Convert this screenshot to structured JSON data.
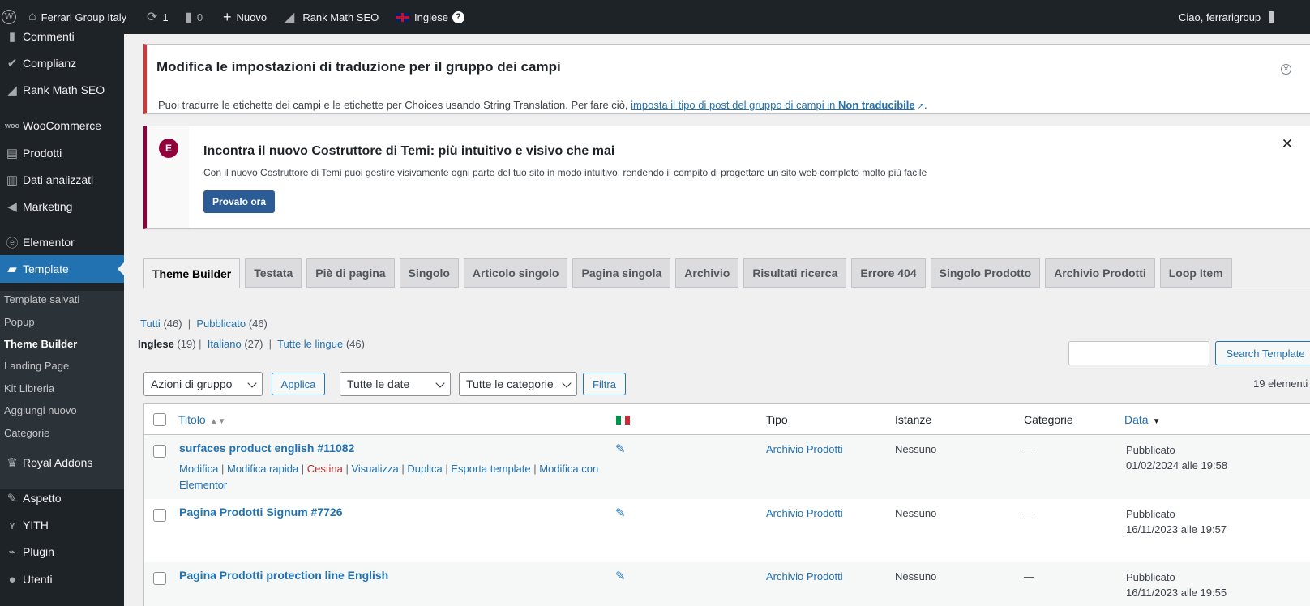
{
  "admin_bar": {
    "site_name": "Ferrari Group Italy",
    "updates_count": "1",
    "comments_count": "0",
    "new_label": "Nuovo",
    "rank_math_label": "Rank Math SEO",
    "language_label": "Inglese",
    "help_label": "?",
    "greeting": "Ciao, ferrarigroup"
  },
  "sidebar": {
    "items": [
      {
        "label": "Commenti",
        "icon": "comment-icon"
      },
      {
        "label": "Complianz",
        "icon": "check-icon"
      },
      {
        "label": "Rank Math SEO",
        "icon": "chart-icon"
      },
      {
        "label": "WooCommerce",
        "icon": "woo-icon"
      },
      {
        "label": "Prodotti",
        "icon": "archive-icon"
      },
      {
        "label": "Dati analizzati",
        "icon": "bar-chart-icon"
      },
      {
        "label": "Marketing",
        "icon": "megaphone-icon"
      },
      {
        "label": "Elementor",
        "icon": "elementor-icon"
      },
      {
        "label": "Template",
        "icon": "folder-icon"
      },
      {
        "label": "Royal Addons",
        "icon": "crown-icon"
      },
      {
        "label": "Aspetto",
        "icon": "brush-icon"
      },
      {
        "label": "YITH",
        "icon": "yith-icon"
      },
      {
        "label": "Plugin",
        "icon": "plug-icon"
      },
      {
        "label": "Utenti",
        "icon": "user-icon"
      }
    ],
    "submenu": [
      "Template salvati",
      "Popup",
      "Theme Builder",
      "Landing Page",
      "Kit Libreria",
      "Aggiungi nuovo",
      "Categorie"
    ]
  },
  "acf_notice": {
    "title": "Modifica le impostazioni di traduzione per il gruppo dei campi",
    "text": "Puoi tradurre le etichette dei campi e le etichette per Choices usando String Translation. Per fare ciò, ",
    "link_text": "imposta il tipo di post del gruppo di campi in ",
    "link_bold": "Non traducibile",
    "link_suffix": "."
  },
  "elementor_notice": {
    "logo": "E",
    "title": "Incontra il nuovo Costruttore di Temi: più intuitivo e visivo che mai",
    "text": "Con il nuovo Costruttore di Temi puoi gestire visivamente ogni parte del tuo sito in modo intuitivo, rendendo il compito di progettare un sito web completo molto più facile",
    "button": "Provalo ora"
  },
  "tabs": [
    "Theme Builder",
    "Testata",
    "Piè di pagina",
    "Singolo",
    "Articolo singolo",
    "Pagina singola",
    "Archivio",
    "Risultati ricerca",
    "Errore 404",
    "Singolo Prodotto",
    "Archivio Prodotti",
    "Loop Item"
  ],
  "views": {
    "all_label": "Tutti",
    "all_count": "(46)",
    "pub_label": "Pubblicato",
    "pub_count": "(46)",
    "lang_current": "Inglese",
    "lang_current_count": "(19)",
    "lang_it": "Italiano",
    "lang_it_count": "(27)",
    "lang_all": "Tutte le lingue",
    "lang_all_count": "(46)"
  },
  "search": {
    "button": "Search Template"
  },
  "filters": {
    "bulk_action": "Azioni di gruppo",
    "apply": "Applica",
    "dates": "Tutte le date",
    "categories": "Tutte le categorie",
    "filter": "Filtra",
    "count": "19 elementi"
  },
  "table": {
    "headers": {
      "title": "Titolo",
      "type": "Tipo",
      "instances": "Istanze",
      "categories": "Categorie",
      "date": "Data"
    },
    "row_actions": {
      "edit": "Modifica",
      "quick_edit": "Modifica rapida",
      "trash": "Cestina",
      "view": "Visualizza",
      "duplicate": "Duplica",
      "export": "Esporta template",
      "edit_elementor": "Modifica con Elementor"
    },
    "rows": [
      {
        "title": "surfaces product english #11082",
        "type": "Archivio Prodotti",
        "instances": "Nessuno",
        "category": "—",
        "status": "Pubblicato",
        "date": "01/02/2024 alle 19:58"
      },
      {
        "title": "Pagina Prodotti Signum #7726",
        "type": "Archivio Prodotti",
        "instances": "Nessuno",
        "category": "—",
        "status": "Pubblicato",
        "date": "16/11/2023 alle 19:57"
      },
      {
        "title": "Pagina Prodotti protection line English",
        "type": "Archivio Prodotti",
        "instances": "Nessuno",
        "category": "—",
        "status": "Pubblicato",
        "date": "16/11/2023 alle 19:55"
      }
    ]
  },
  "colors": {
    "accent": "#2271b1",
    "admin_dark": "#1d2327",
    "elementor": "#92003b",
    "error": "#d63638"
  }
}
